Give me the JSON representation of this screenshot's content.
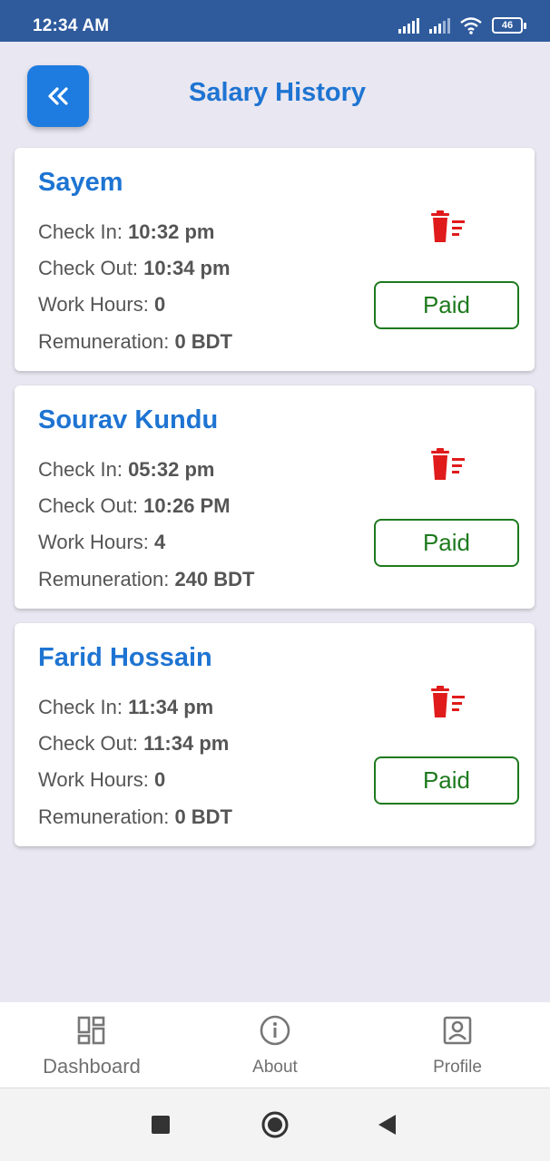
{
  "status_bar": {
    "time": "12:34 AM",
    "battery": "46"
  },
  "header": {
    "title": "Salary History",
    "back_icon": "double-chevron-left-icon"
  },
  "labels": {
    "check_in": "Check In:",
    "check_out": "Check Out:",
    "work_hours": "Work Hours:",
    "remuneration": "Remuneration:"
  },
  "records": [
    {
      "name": "Sayem",
      "check_in": "10:32 pm",
      "check_out": "10:34 pm",
      "work_hours": "0",
      "remuneration": "0 BDT",
      "status": "Paid"
    },
    {
      "name": "Sourav Kundu",
      "check_in": "05:32 pm",
      "check_out": "10:26 PM",
      "work_hours": "4",
      "remuneration": "240 BDT",
      "status": "Paid"
    },
    {
      "name": "Farid Hossain",
      "check_in": "11:34 pm",
      "check_out": "11:34 pm",
      "work_hours": "0",
      "remuneration": "0 BDT",
      "status": "Paid"
    }
  ],
  "bottom_nav": [
    {
      "label": "Dashboard",
      "icon": "dashboard-icon"
    },
    {
      "label": "About",
      "icon": "info-icon"
    },
    {
      "label": "Profile",
      "icon": "profile-icon"
    }
  ],
  "colors": {
    "status_bar": "#2f5b9d",
    "accent": "#1e74d2",
    "paid_green": "#1e7a1e",
    "delete_red": "#e01b1b",
    "background": "#e9e7f1"
  }
}
